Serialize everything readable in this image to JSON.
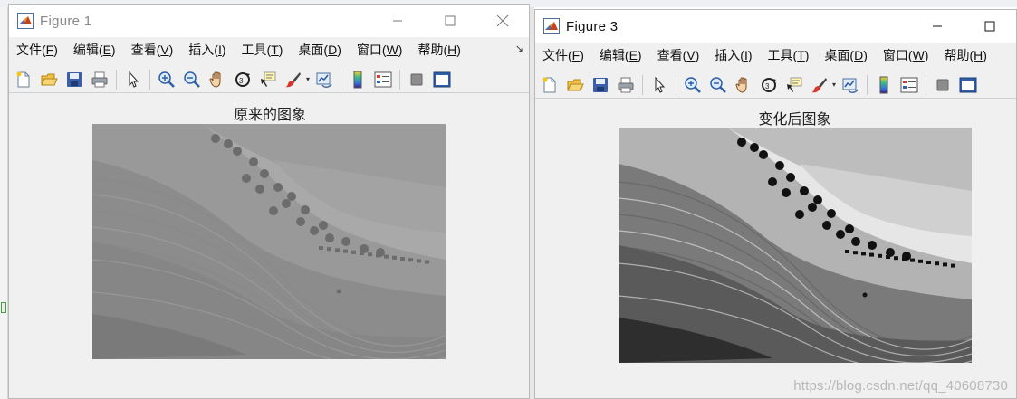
{
  "menu_labels": [
    {
      "label": "文件(",
      "key": "F",
      "close": ")"
    },
    {
      "label": "编辑(",
      "key": "E",
      "close": ")"
    },
    {
      "label": "查看(",
      "key": "V",
      "close": ")"
    },
    {
      "label": "插入(",
      "key": "I",
      "close": ")"
    },
    {
      "label": "工具(",
      "key": "T",
      "close": ")"
    },
    {
      "label": "桌面(",
      "key": "D",
      "close": ")"
    },
    {
      "label": "窗口(",
      "key": "W",
      "close": ")"
    },
    {
      "label": "帮助(",
      "key": "H",
      "close": ")"
    }
  ],
  "toolbar_icons": [
    "new-figure-icon",
    "open-file-icon",
    "save-icon",
    "print-icon",
    "select-arrow-icon",
    "zoom-in-icon",
    "zoom-out-icon",
    "pan-hand-icon",
    "rotate-3d-icon",
    "data-cursor-icon",
    "brush-icon",
    "link-plot-icon",
    "colorbar-icon",
    "legend-icon",
    "hide-plot-tools-icon",
    "show-plot-tools-icon"
  ],
  "figure1": {
    "title": "Figure 1",
    "axes_title": "原来的图象",
    "image_style": "low-contrast"
  },
  "figure3": {
    "title": "Figure 3",
    "axes_title": "变化后图象",
    "image_style": "high-contrast"
  },
  "window_controls": {
    "minimize": "—",
    "maximize": "☐",
    "close": "✕"
  },
  "watermark": "https://blog.csdn.net/qq_40608730",
  "colors": {
    "window_bg": "#f0f0f0",
    "titlebar_bg": "#ffffff",
    "inactive_title": "#888888",
    "active_title": "#111111"
  }
}
